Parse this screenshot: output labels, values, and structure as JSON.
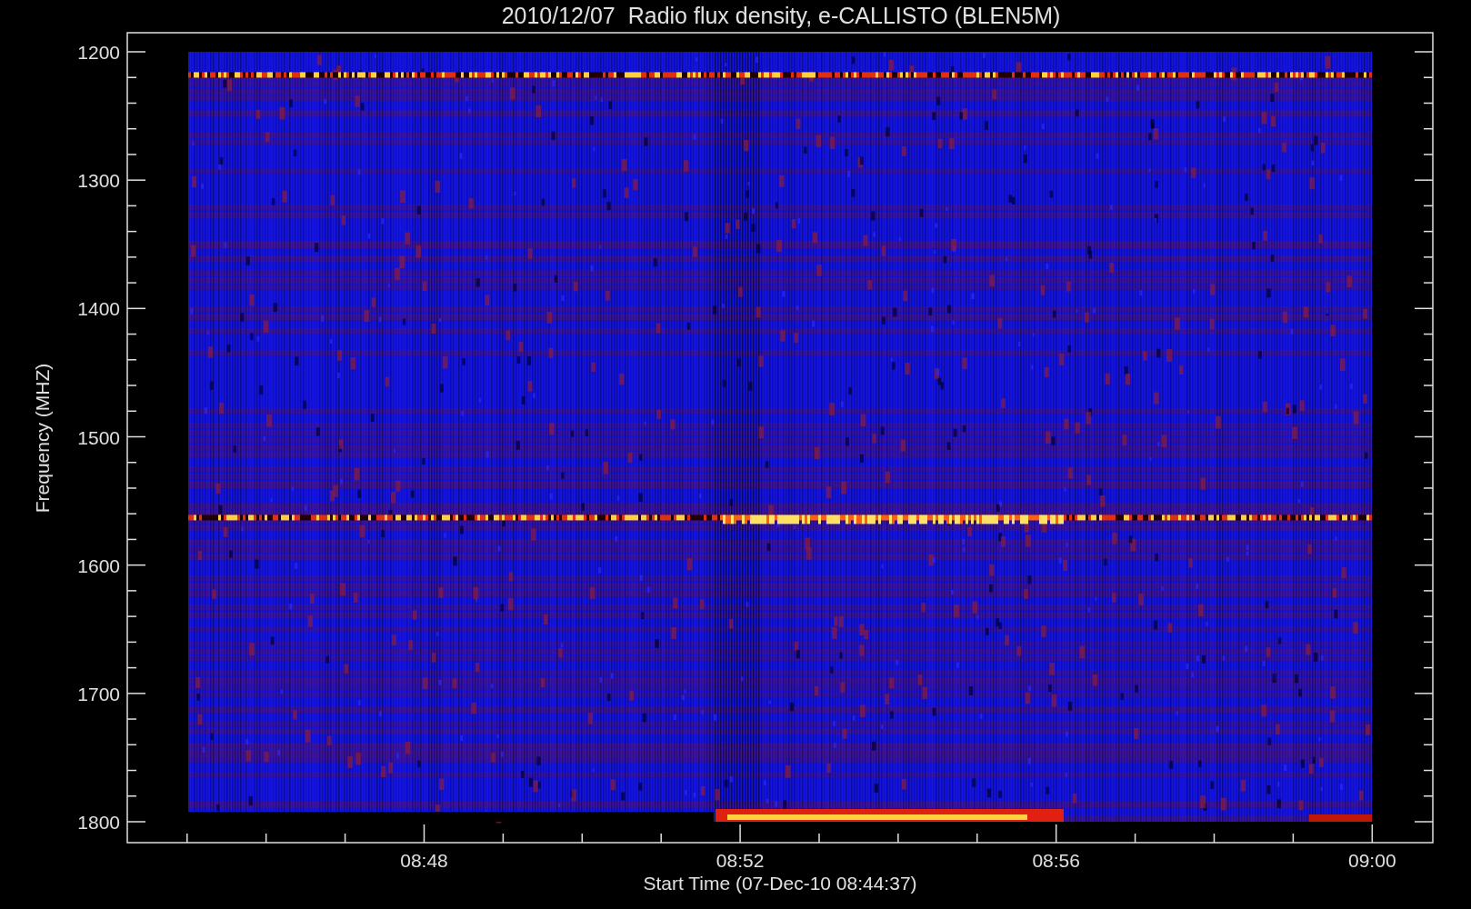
{
  "title": "2010/12/07  Radio flux density, e-CALLISTO (BLEN5M)",
  "y_axis": {
    "title": "Frequency (MHZ)",
    "ticks": [
      "1200",
      "1300",
      "1400",
      "1500",
      "1600",
      "1700",
      "1800"
    ]
  },
  "x_axis": {
    "title": "Start Time (07-Dec-10 08:44:37)",
    "ticks": [
      "08:48",
      "08:52",
      "08:56",
      "09:00"
    ]
  }
}
